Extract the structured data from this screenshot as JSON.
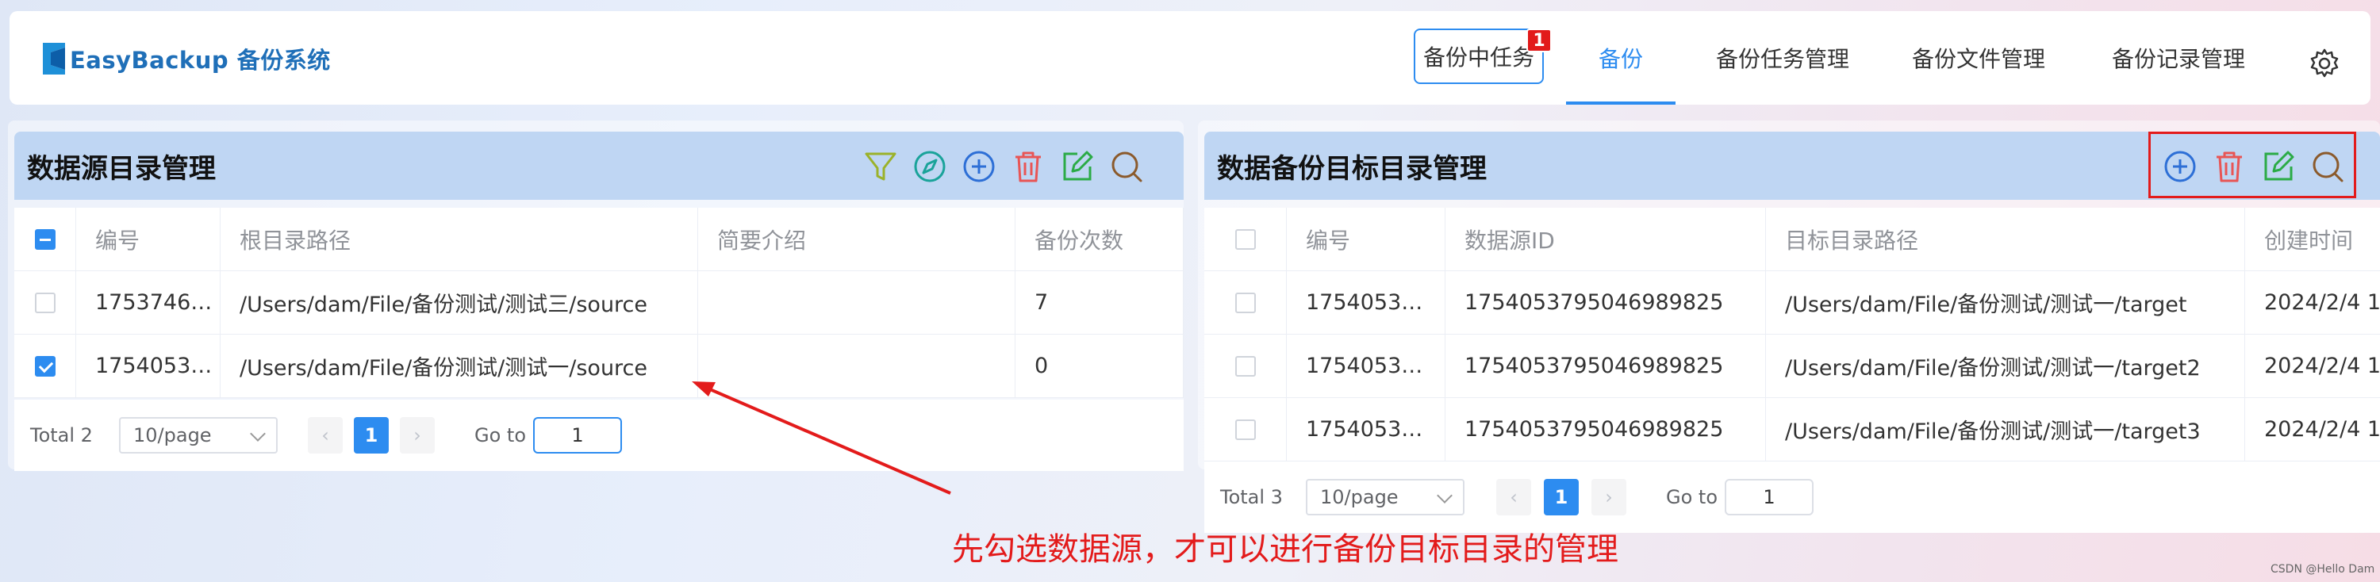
{
  "app": {
    "logo_text": "EasyBackup 备份系统"
  },
  "nav": {
    "task_button": "备份中任务",
    "task_badge": "1",
    "items": [
      {
        "label": "备份",
        "active": true
      },
      {
        "label": "备份任务管理"
      },
      {
        "label": "备份文件管理"
      },
      {
        "label": "备份记录管理"
      }
    ],
    "settings_icon": "gear-icon"
  },
  "left_panel": {
    "title": "数据源目录管理",
    "tools": [
      "filter-icon",
      "compass-icon",
      "plus-circle-icon",
      "trash-icon",
      "edit-icon",
      "search-icon"
    ],
    "columns": [
      "编号",
      "根目录路径",
      "简要介绍",
      "备份次数"
    ],
    "rows": [
      {
        "checked": false,
        "id": "1753746…",
        "path": "/Users/dam/File/备份测试/测试三/source",
        "desc": "",
        "count": "7"
      },
      {
        "checked": true,
        "id": "1754053…",
        "path": "/Users/dam/File/备份测试/测试一/source",
        "desc": "",
        "count": "0"
      }
    ],
    "pager": {
      "total": "Total 2",
      "page_size": "10/page",
      "current": "1",
      "goto_label": "Go to",
      "goto_value": "1"
    }
  },
  "right_panel": {
    "title": "数据备份目标目录管理",
    "tools": [
      "plus-circle-icon",
      "trash-icon",
      "edit-icon",
      "search-icon"
    ],
    "columns": [
      "编号",
      "数据源ID",
      "目标目录路径",
      "创建时间"
    ],
    "rows": [
      {
        "checked": false,
        "id": "1754053…",
        "source_id": "1754053795046989825",
        "path": "/Users/dam/File/备份测试/测试一/target",
        "created": "2024/2/4 1"
      },
      {
        "checked": false,
        "id": "1754053…",
        "source_id": "1754053795046989825",
        "path": "/Users/dam/File/备份测试/测试一/target2",
        "created": "2024/2/4 1"
      },
      {
        "checked": false,
        "id": "1754053…",
        "source_id": "1754053795046989825",
        "path": "/Users/dam/File/备份测试/测试一/target3",
        "created": "2024/2/4 1"
      }
    ],
    "pager": {
      "total": "Total 3",
      "page_size": "10/page",
      "current": "1",
      "goto_label": "Go to",
      "goto_value": "1"
    }
  },
  "annotation": "先勾选数据源，才可以进行备份目标目录的管理",
  "watermark": "CSDN @Hello Dam",
  "colors": {
    "primary": "#2d8cf0",
    "annotation_red": "#e31b1b",
    "panel_header": "#bfd6f3"
  }
}
